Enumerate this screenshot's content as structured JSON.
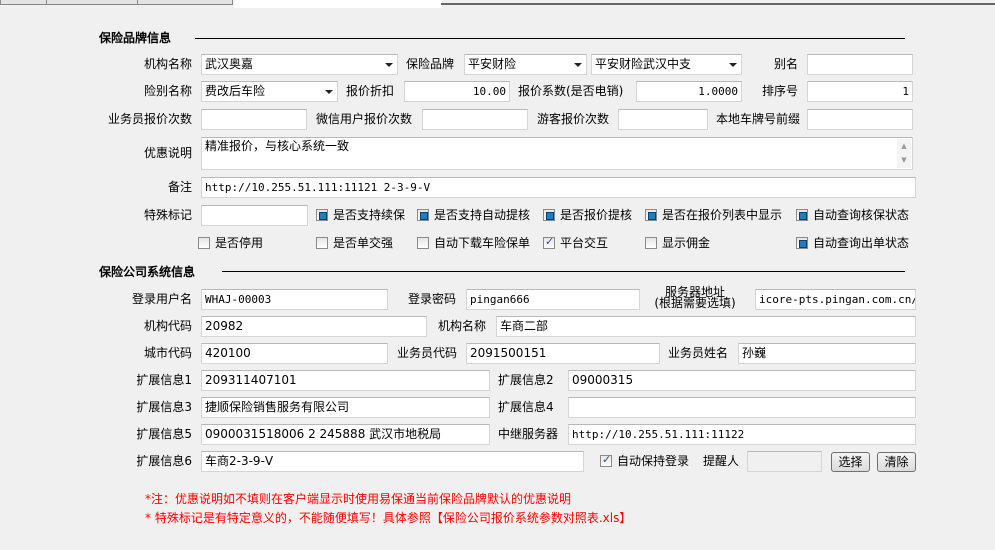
{
  "brand_section": {
    "title": "保险品牌信息",
    "org_name_label": "机构名称",
    "org_name": "武汉奥嘉",
    "brand_label": "保险品牌",
    "brand": "平安财险",
    "branch": "平安财险武汉中支",
    "alias_label": "别名",
    "alias": "",
    "insurance_type_label": "险别名称",
    "insurance_type": "费改后车险",
    "discount_label": "报价折扣",
    "discount": "10.00",
    "coefficient_label": "报价系数(是否电销)",
    "coefficient": "1.0000",
    "sort_label": "排序号",
    "sort": "1",
    "agent_quote_label": "业务员报价次数",
    "agent_quote": "",
    "wechat_quote_label": "微信用户报价次数",
    "wechat_quote": "",
    "guest_quote_label": "游客报价次数",
    "guest_quote": "",
    "plate_prefix_label": "本地车牌号前缀",
    "plate_prefix": "",
    "promo_label": "优惠说明",
    "promo": "精准报价，与核心系统一致",
    "remark_label": "备注",
    "remark": "http://10.255.51.111:11121  2-3-9-V",
    "special_label": "特殊标记",
    "special": "",
    "checkboxes_row1": [
      {
        "label": "是否支持续保",
        "state": "indeterminate"
      },
      {
        "label": "是否支持自动提核",
        "state": "indeterminate"
      },
      {
        "label": "是否报价提核",
        "state": "indeterminate"
      },
      {
        "label": "是否在报价列表中显示",
        "state": "indeterminate"
      },
      {
        "label": "自动查询核保状态",
        "state": "indeterminate"
      }
    ],
    "checkboxes_row2": [
      {
        "label": "是否停用",
        "state": "unchecked"
      },
      {
        "label": "是否单交强",
        "state": "unchecked"
      },
      {
        "label": "自动下载车险保单",
        "state": "unchecked"
      },
      {
        "label": "平台交互",
        "state": "checked"
      },
      {
        "label": "显示佣金",
        "state": "unchecked"
      },
      {
        "label": "自动查询出单状态",
        "state": "indeterminate"
      }
    ]
  },
  "system_section": {
    "title": "保险公司系统信息",
    "username_label": "登录用户名",
    "username": "WHAJ-00003",
    "password_label": "登录密码",
    "password": "pingan666",
    "server_label_1": "服务器地址",
    "server_label_2": "(根据需要选填)",
    "server": "icore-pts.pingan.com.cn/ebu",
    "org_code_label": "机构代码",
    "org_code": "20982",
    "org_name_label": "机构名称",
    "org_name": "车商二部",
    "city_code_label": "城市代码",
    "city_code": "420100",
    "agent_code_label": "业务员代码",
    "agent_code": "2091500151",
    "agent_name_label": "业务员姓名",
    "agent_name": "孙巍",
    "ext1_label": "扩展信息1",
    "ext1": "209311407101",
    "ext2_label": "扩展信息2",
    "ext2": "09000315",
    "ext3_label": "扩展信息3",
    "ext3": "捷顺保险销售服务有限公司",
    "ext4_label": "扩展信息4",
    "ext4": "",
    "ext5_label": "扩展信息5",
    "ext5": "0900031518006 2 245888 武汉市地税局",
    "relay_label": "中继服务器",
    "relay": "http://10.255.51.111:11122",
    "ext6_label": "扩展信息6",
    "ext6": "车商2-3-9-V",
    "keep_login_label": "自动保持登录",
    "keep_login": "checked",
    "reminder_label": "提醒人",
    "reminder": "",
    "select_button": "选择",
    "clear_button": "清除"
  },
  "notes": [
    "*注：优惠说明如不填则在客户端显示时使用易保通当前保险品牌默认的优惠说明",
    "* 特殊标记是有特定意义的，不能随便填写！具体参照【保险公司报价系统参数对照表.xls】"
  ]
}
